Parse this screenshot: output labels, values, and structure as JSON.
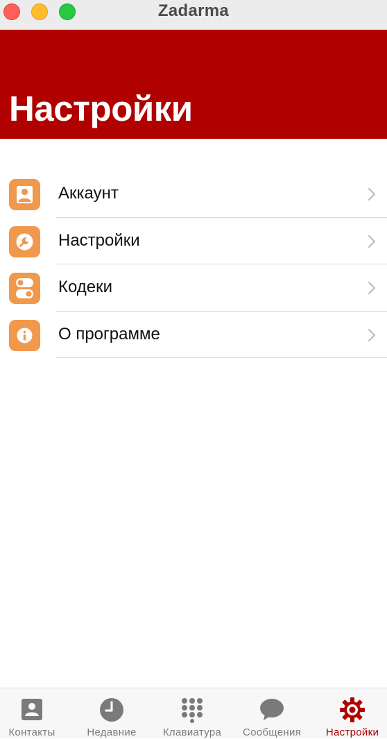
{
  "window": {
    "title": "Zadarma"
  },
  "header": {
    "title": "Настройки",
    "background": "#b00000"
  },
  "menu": {
    "icon_color": "#f0984c",
    "items": [
      {
        "label": "Аккаунт",
        "icon": "person-icon"
      },
      {
        "label": "Настройки",
        "icon": "wrench-icon"
      },
      {
        "label": "Кодеки",
        "icon": "toggles-icon"
      },
      {
        "label": "О программе",
        "icon": "info-icon"
      }
    ]
  },
  "tabbar": {
    "active_color": "#b00000",
    "inactive_color": "#7a7a7a",
    "tabs": [
      {
        "label": "Контакты",
        "icon": "contact-card-icon",
        "active": false
      },
      {
        "label": "Недавние",
        "icon": "clock-icon",
        "active": false
      },
      {
        "label": "Клавиатура",
        "icon": "keypad-icon",
        "active": false
      },
      {
        "label": "Сообщения",
        "icon": "chat-bubble-icon",
        "active": false
      },
      {
        "label": "Настройки",
        "icon": "gear-icon",
        "active": true
      }
    ]
  }
}
